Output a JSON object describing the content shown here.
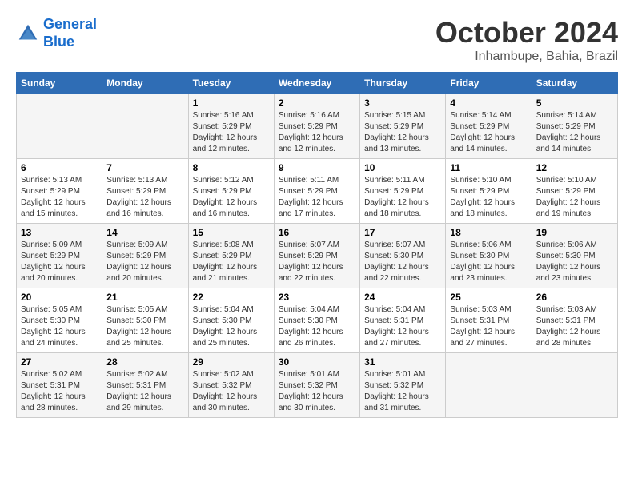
{
  "logo": {
    "line1": "General",
    "line2": "Blue"
  },
  "header": {
    "month": "October 2024",
    "location": "Inhambupe, Bahia, Brazil"
  },
  "weekdays": [
    "Sunday",
    "Monday",
    "Tuesday",
    "Wednesday",
    "Thursday",
    "Friday",
    "Saturday"
  ],
  "weeks": [
    [
      {
        "day": "",
        "sunrise": "",
        "sunset": "",
        "daylight": ""
      },
      {
        "day": "",
        "sunrise": "",
        "sunset": "",
        "daylight": ""
      },
      {
        "day": "1",
        "sunrise": "Sunrise: 5:16 AM",
        "sunset": "Sunset: 5:29 PM",
        "daylight": "Daylight: 12 hours and 12 minutes."
      },
      {
        "day": "2",
        "sunrise": "Sunrise: 5:16 AM",
        "sunset": "Sunset: 5:29 PM",
        "daylight": "Daylight: 12 hours and 12 minutes."
      },
      {
        "day": "3",
        "sunrise": "Sunrise: 5:15 AM",
        "sunset": "Sunset: 5:29 PM",
        "daylight": "Daylight: 12 hours and 13 minutes."
      },
      {
        "day": "4",
        "sunrise": "Sunrise: 5:14 AM",
        "sunset": "Sunset: 5:29 PM",
        "daylight": "Daylight: 12 hours and 14 minutes."
      },
      {
        "day": "5",
        "sunrise": "Sunrise: 5:14 AM",
        "sunset": "Sunset: 5:29 PM",
        "daylight": "Daylight: 12 hours and 14 minutes."
      }
    ],
    [
      {
        "day": "6",
        "sunrise": "Sunrise: 5:13 AM",
        "sunset": "Sunset: 5:29 PM",
        "daylight": "Daylight: 12 hours and 15 minutes."
      },
      {
        "day": "7",
        "sunrise": "Sunrise: 5:13 AM",
        "sunset": "Sunset: 5:29 PM",
        "daylight": "Daylight: 12 hours and 16 minutes."
      },
      {
        "day": "8",
        "sunrise": "Sunrise: 5:12 AM",
        "sunset": "Sunset: 5:29 PM",
        "daylight": "Daylight: 12 hours and 16 minutes."
      },
      {
        "day": "9",
        "sunrise": "Sunrise: 5:11 AM",
        "sunset": "Sunset: 5:29 PM",
        "daylight": "Daylight: 12 hours and 17 minutes."
      },
      {
        "day": "10",
        "sunrise": "Sunrise: 5:11 AM",
        "sunset": "Sunset: 5:29 PM",
        "daylight": "Daylight: 12 hours and 18 minutes."
      },
      {
        "day": "11",
        "sunrise": "Sunrise: 5:10 AM",
        "sunset": "Sunset: 5:29 PM",
        "daylight": "Daylight: 12 hours and 18 minutes."
      },
      {
        "day": "12",
        "sunrise": "Sunrise: 5:10 AM",
        "sunset": "Sunset: 5:29 PM",
        "daylight": "Daylight: 12 hours and 19 minutes."
      }
    ],
    [
      {
        "day": "13",
        "sunrise": "Sunrise: 5:09 AM",
        "sunset": "Sunset: 5:29 PM",
        "daylight": "Daylight: 12 hours and 20 minutes."
      },
      {
        "day": "14",
        "sunrise": "Sunrise: 5:09 AM",
        "sunset": "Sunset: 5:29 PM",
        "daylight": "Daylight: 12 hours and 20 minutes."
      },
      {
        "day": "15",
        "sunrise": "Sunrise: 5:08 AM",
        "sunset": "Sunset: 5:29 PM",
        "daylight": "Daylight: 12 hours and 21 minutes."
      },
      {
        "day": "16",
        "sunrise": "Sunrise: 5:07 AM",
        "sunset": "Sunset: 5:29 PM",
        "daylight": "Daylight: 12 hours and 22 minutes."
      },
      {
        "day": "17",
        "sunrise": "Sunrise: 5:07 AM",
        "sunset": "Sunset: 5:30 PM",
        "daylight": "Daylight: 12 hours and 22 minutes."
      },
      {
        "day": "18",
        "sunrise": "Sunrise: 5:06 AM",
        "sunset": "Sunset: 5:30 PM",
        "daylight": "Daylight: 12 hours and 23 minutes."
      },
      {
        "day": "19",
        "sunrise": "Sunrise: 5:06 AM",
        "sunset": "Sunset: 5:30 PM",
        "daylight": "Daylight: 12 hours and 23 minutes."
      }
    ],
    [
      {
        "day": "20",
        "sunrise": "Sunrise: 5:05 AM",
        "sunset": "Sunset: 5:30 PM",
        "daylight": "Daylight: 12 hours and 24 minutes."
      },
      {
        "day": "21",
        "sunrise": "Sunrise: 5:05 AM",
        "sunset": "Sunset: 5:30 PM",
        "daylight": "Daylight: 12 hours and 25 minutes."
      },
      {
        "day": "22",
        "sunrise": "Sunrise: 5:04 AM",
        "sunset": "Sunset: 5:30 PM",
        "daylight": "Daylight: 12 hours and 25 minutes."
      },
      {
        "day": "23",
        "sunrise": "Sunrise: 5:04 AM",
        "sunset": "Sunset: 5:30 PM",
        "daylight": "Daylight: 12 hours and 26 minutes."
      },
      {
        "day": "24",
        "sunrise": "Sunrise: 5:04 AM",
        "sunset": "Sunset: 5:31 PM",
        "daylight": "Daylight: 12 hours and 27 minutes."
      },
      {
        "day": "25",
        "sunrise": "Sunrise: 5:03 AM",
        "sunset": "Sunset: 5:31 PM",
        "daylight": "Daylight: 12 hours and 27 minutes."
      },
      {
        "day": "26",
        "sunrise": "Sunrise: 5:03 AM",
        "sunset": "Sunset: 5:31 PM",
        "daylight": "Daylight: 12 hours and 28 minutes."
      }
    ],
    [
      {
        "day": "27",
        "sunrise": "Sunrise: 5:02 AM",
        "sunset": "Sunset: 5:31 PM",
        "daylight": "Daylight: 12 hours and 28 minutes."
      },
      {
        "day": "28",
        "sunrise": "Sunrise: 5:02 AM",
        "sunset": "Sunset: 5:31 PM",
        "daylight": "Daylight: 12 hours and 29 minutes."
      },
      {
        "day": "29",
        "sunrise": "Sunrise: 5:02 AM",
        "sunset": "Sunset: 5:32 PM",
        "daylight": "Daylight: 12 hours and 30 minutes."
      },
      {
        "day": "30",
        "sunrise": "Sunrise: 5:01 AM",
        "sunset": "Sunset: 5:32 PM",
        "daylight": "Daylight: 12 hours and 30 minutes."
      },
      {
        "day": "31",
        "sunrise": "Sunrise: 5:01 AM",
        "sunset": "Sunset: 5:32 PM",
        "daylight": "Daylight: 12 hours and 31 minutes."
      },
      {
        "day": "",
        "sunrise": "",
        "sunset": "",
        "daylight": ""
      },
      {
        "day": "",
        "sunrise": "",
        "sunset": "",
        "daylight": ""
      }
    ]
  ]
}
